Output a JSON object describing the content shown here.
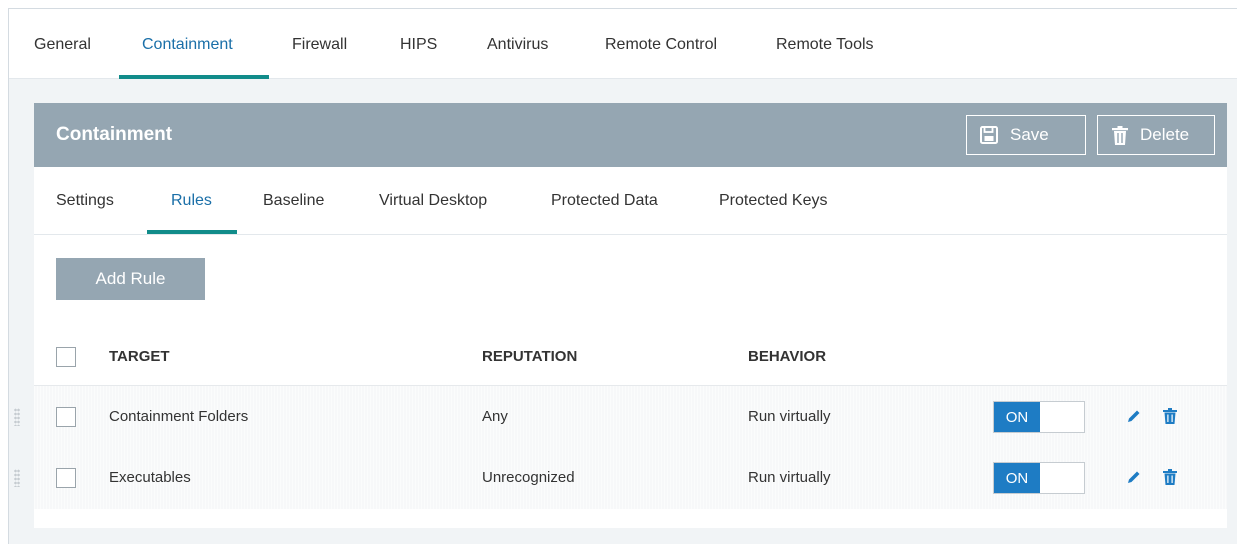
{
  "top_tabs": [
    {
      "label": "General"
    },
    {
      "label": "Containment",
      "active": true
    },
    {
      "label": "Firewall"
    },
    {
      "label": "HIPS"
    },
    {
      "label": "Antivirus"
    },
    {
      "label": "Remote Control"
    },
    {
      "label": "Remote Tools"
    }
  ],
  "panel": {
    "title": "Containment",
    "save_label": "Save",
    "delete_label": "Delete",
    "icons": {
      "save": "floppy-disk-icon",
      "delete": "trash-icon"
    }
  },
  "sub_tabs": [
    {
      "label": "Settings"
    },
    {
      "label": "Rules",
      "active": true
    },
    {
      "label": "Baseline"
    },
    {
      "label": "Virtual Desktop"
    },
    {
      "label": "Protected Data"
    },
    {
      "label": "Protected Keys"
    }
  ],
  "add_rule_label": "Add Rule",
  "table": {
    "columns": [
      "TARGET",
      "REPUTATION",
      "BEHAVIOR"
    ],
    "rows": [
      {
        "target": "Containment Folders",
        "reputation": "Any",
        "behavior": "Run virtually",
        "toggle": "ON"
      },
      {
        "target": "Executables",
        "reputation": "Unrecognized",
        "behavior": "Run virtually",
        "toggle": "ON"
      }
    ]
  },
  "colors": {
    "accent_underline": "#118c8a",
    "active_tab_text": "#1a6fa8",
    "header_bg": "#95a6b2",
    "toggle_on": "#1e7cc4",
    "action_icons": "#1e7cc4"
  }
}
